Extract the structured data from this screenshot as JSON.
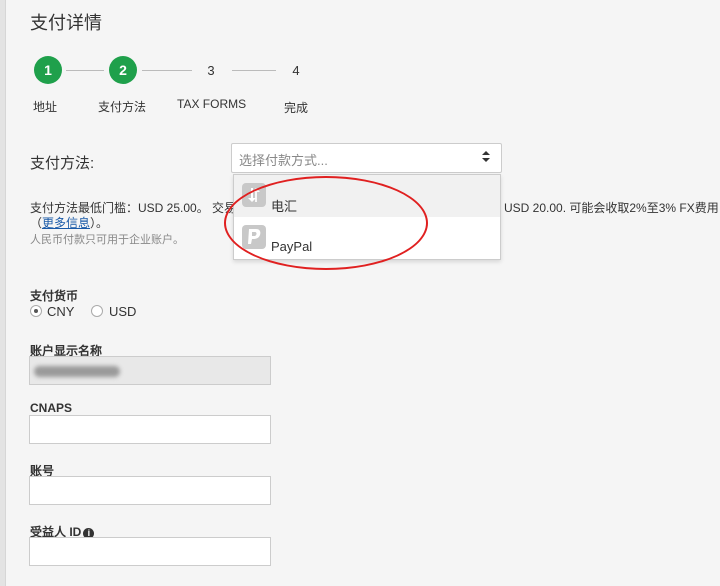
{
  "page": {
    "title": "支付详情"
  },
  "stepper": {
    "steps": [
      {
        "number": "1",
        "label": "地址",
        "state": "done"
      },
      {
        "number": "2",
        "label": "支付方法",
        "state": "done"
      },
      {
        "number": "3",
        "label": "TAX FORMS",
        "state": "pending"
      },
      {
        "number": "4",
        "label": "完成",
        "state": "pending"
      }
    ],
    "active_color": "#1fa04b"
  },
  "payment_method": {
    "label": "支付方法:",
    "select_placeholder": "选择付款方式...",
    "dropdown_options": [
      {
        "icon": "wire-transfer-icon",
        "label": "电汇"
      },
      {
        "icon": "paypal-icon",
        "label": "PayPal"
      }
    ],
    "info_line1_a": "支付方法最低门槛：USD 25.00。 交易",
    "info_line1_b": "USD 20.00. 可能会收取2%至3% FX费用",
    "info_line2_prefix": "（",
    "info_line2_link": "更多信息",
    "info_line2_suffix": "）。",
    "info_line3": "人民币付款只可用于企业账户。"
  },
  "currency": {
    "label": "支付货币",
    "options": [
      {
        "label": "CNY",
        "checked": true
      },
      {
        "label": "USD",
        "checked": false
      }
    ]
  },
  "fields": {
    "display_name_label": "账户显示名称",
    "cnaps_label": "CNAPS",
    "account_label": "账号",
    "beneficiary_label": "受益人 ID",
    "next_label_partial": "_ _ _ _ _"
  },
  "annotation": {
    "color": "#e02020"
  }
}
